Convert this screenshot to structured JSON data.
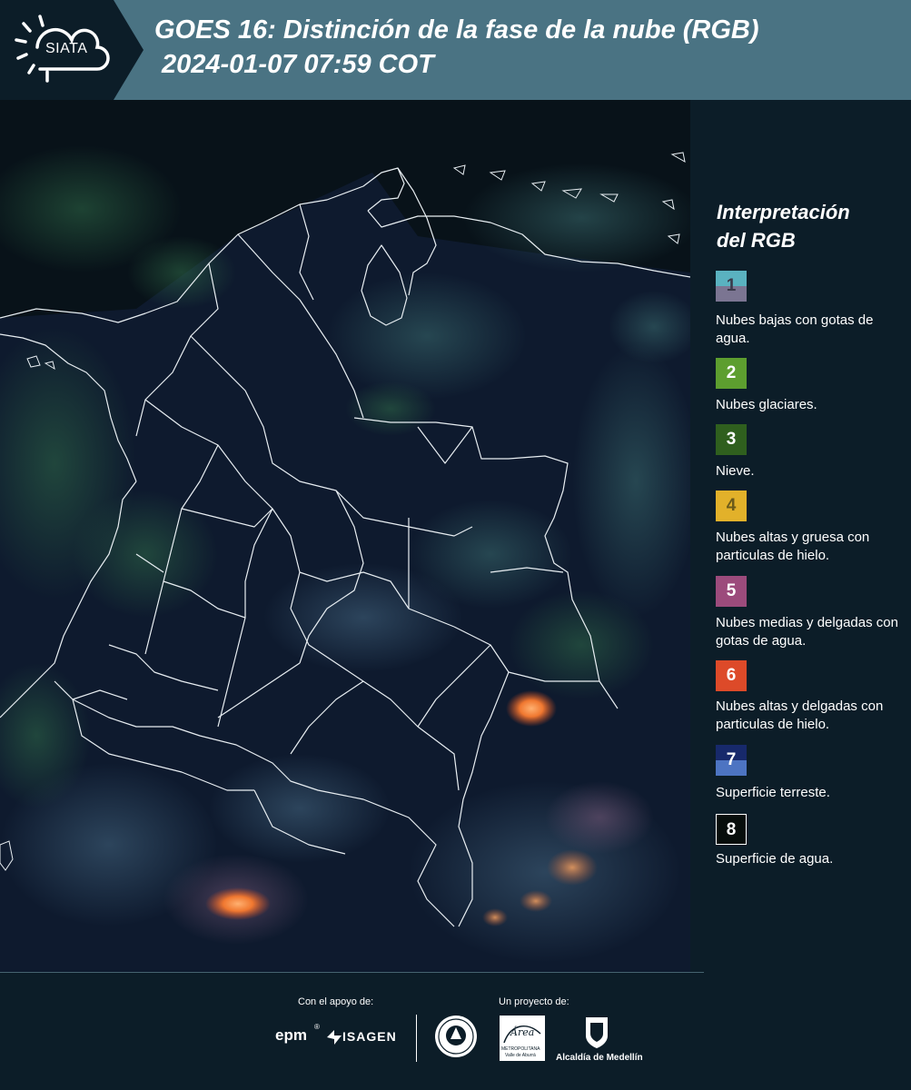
{
  "header": {
    "logo_text": "SIATA",
    "title_line1": "GOES 16: Distinción de la fase de la nube (RGB)",
    "title_line2": "2024-01-07 07:59 COT"
  },
  "legend": {
    "title_line1": "Interpretación",
    "title_line2": "del RGB",
    "items": [
      {
        "number": "1",
        "label": "Nubes bajas con gotas de agua.",
        "color_top": "#5ab2c0",
        "color_bottom": "#7b7592"
      },
      {
        "number": "2",
        "label": "Nubes glaciares.",
        "color": "#5d9e2f"
      },
      {
        "number": "3",
        "label": "Nieve.",
        "color": "#2f5f1e"
      },
      {
        "number": "4",
        "label": "Nubes altas y gruesa con particulas de hielo.",
        "color": "#e2b12a"
      },
      {
        "number": "5",
        "label": "Nubes medias y delgadas con gotas de agua.",
        "color": "#9c4b7c"
      },
      {
        "number": "6",
        "label": "Nubes altas y delgadas con particulas de hielo.",
        "color": "#dd4a29"
      },
      {
        "number": "7",
        "label": "Superficie terreste.",
        "color_top": "#17296b",
        "color_bottom": "#4d74c2"
      },
      {
        "number": "8",
        "label": "Superficie de agua.",
        "color": "#070d0b"
      }
    ]
  },
  "footer": {
    "support_label": "Con el apoyo de:",
    "project_label": "Un proyecto de:",
    "logo_epm": "epm",
    "logo_isagen": "ISAGEN",
    "logo_area_line1": "METROPOLITANA",
    "logo_area_line2": "Valle de Aburrá",
    "logo_area_script": "Área",
    "logo_alcaldia": "Alcaldía de Medellín"
  }
}
